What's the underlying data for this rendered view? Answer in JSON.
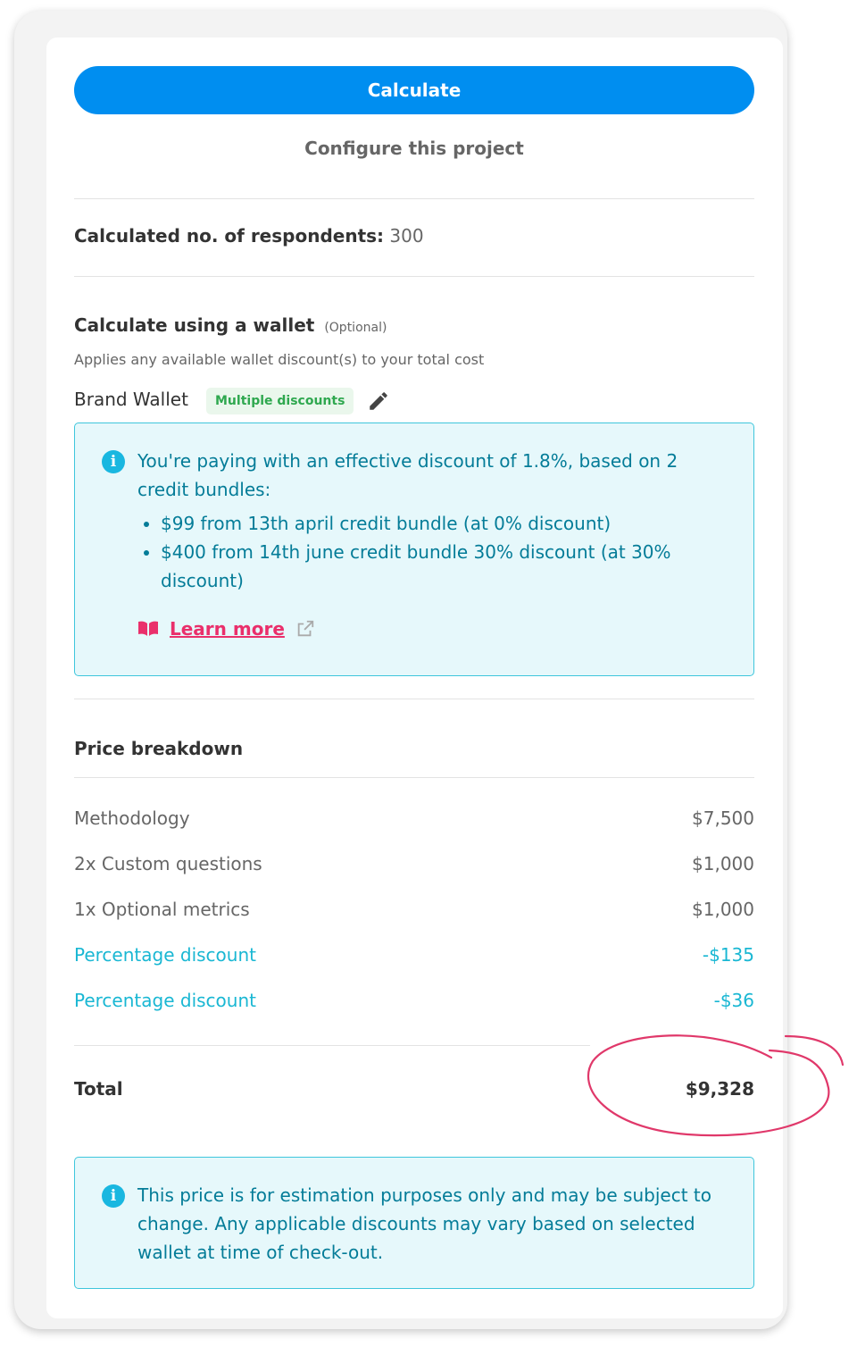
{
  "header": {
    "calculate_label": "Calculate",
    "configure_label": "Configure this project"
  },
  "respondents": {
    "label": "Calculated no. of respondents:",
    "value": "300"
  },
  "wallet": {
    "title": "Calculate using a wallet",
    "optional": "(Optional)",
    "subtitle": "Applies any available wallet discount(s) to your total cost",
    "brand_name": "Brand Wallet",
    "badge": "Multiple discounts",
    "info": {
      "intro": "You're paying with an effective discount of 1.8%, based on 2 credit bundles:",
      "bullets": [
        "$99 from 13th april credit bundle (at 0% discount)",
        "$400 from 14th june credit bundle 30% discount (at 30% discount)"
      ],
      "learn_more": "Learn more"
    }
  },
  "price": {
    "title": "Price breakdown",
    "rows": [
      {
        "label": "Methodology",
        "value": "$7,500"
      },
      {
        "label": "2x Custom questions",
        "value": "$1,000"
      },
      {
        "label": "1x Optional metrics",
        "value": "$1,000"
      },
      {
        "label": "Percentage discount",
        "value": "-$135"
      },
      {
        "label": "Percentage discount",
        "value": "-$36"
      }
    ],
    "total_label": "Total",
    "total_value": "$9,328"
  },
  "disclaimer": "This price is for estimation purposes only and may be subject to change. Any applicable discounts may vary based on selected wallet at time of check-out.",
  "colors": {
    "primary": "#008ef0",
    "info_bg": "#e6f8fb",
    "info_border": "#3ec6dc",
    "info_text": "#047c98",
    "discount": "#19b7d3",
    "link": "#ea2f6b",
    "badge_text": "#2fa84f",
    "annotation": "#e0386a"
  }
}
